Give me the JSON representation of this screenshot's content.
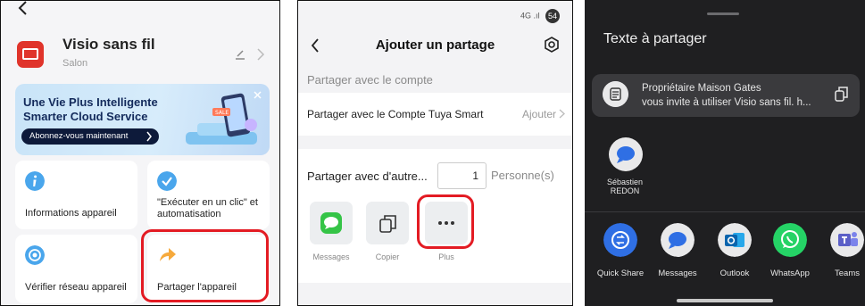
{
  "panel1": {
    "device_title": "Visio sans fil",
    "device_room": "Salon",
    "banner": {
      "line1": "Une Vie Plus Intelligente",
      "line2": "Smarter Cloud Service",
      "button_label": "Abonnez-vous maintenant",
      "sale_tag": "SALE"
    },
    "cards": [
      {
        "label": "Informations appareil",
        "icon": "info-icon"
      },
      {
        "label_line1": "\"Exécuter en un clic\" et",
        "label_line2": "automatisation",
        "icon": "check-shield-icon"
      },
      {
        "label": "Vérifier réseau appareil",
        "icon": "network-icon"
      },
      {
        "label": "Partager l'appareil",
        "icon": "share-arrow-icon"
      }
    ],
    "colors": {
      "accent_blue": "#4aa6ec",
      "share_orange": "#f6a93b",
      "highlight_red": "#e31b23"
    }
  },
  "panel2": {
    "status": {
      "network": "4G",
      "battery": "54"
    },
    "title": "Ajouter un partage",
    "section_account": "Partager avec le compte",
    "row_label": "Partager avec le Compte Tuya Smart",
    "row_action": "Ajouter",
    "others_label": "Partager avec d'autre...",
    "quantity": "1",
    "quantity_unit": "Personne(s)",
    "share_options": [
      {
        "label": "Messages",
        "icon": "messages-icon"
      },
      {
        "label": "Copier",
        "icon": "copy-icon"
      },
      {
        "label": "Plus",
        "icon": "more-icon"
      }
    ]
  },
  "panel3": {
    "title": "Texte à partager",
    "text_line1": "Propriétaire Maison Gates",
    "text_line2": "vous invite à utiliser Visio sans fil. h...",
    "contact": {
      "line1": "Sébastien",
      "line2": "REDON"
    },
    "apps": [
      {
        "label": "Quick Share",
        "color": "#2f6fe4"
      },
      {
        "label": "Messages",
        "color": "#e9e9ea"
      },
      {
        "label": "Outlook",
        "color": "#e9e9ea"
      },
      {
        "label": "WhatsApp",
        "color": "#25d366"
      },
      {
        "label": "Teams",
        "color": "#e9e9ea"
      }
    ]
  }
}
